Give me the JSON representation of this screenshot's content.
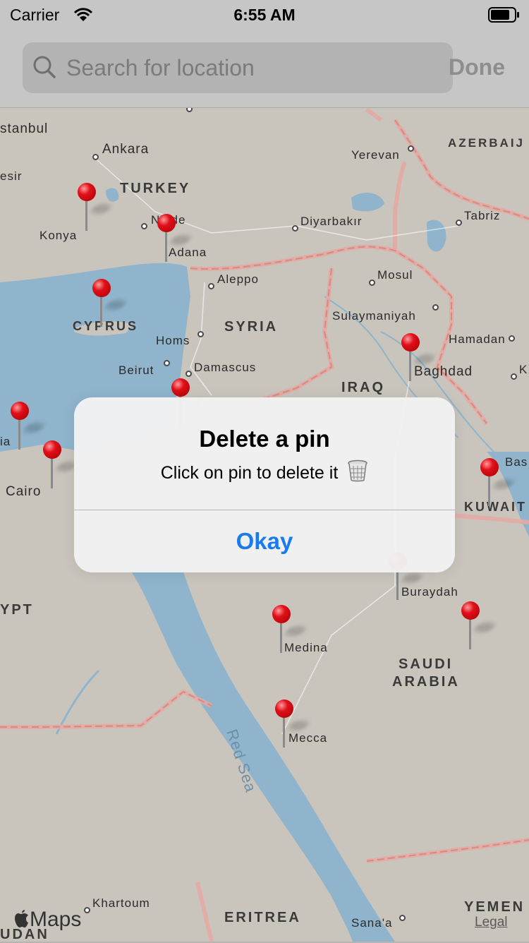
{
  "status_bar": {
    "carrier": "Carrier",
    "time": "6:55 AM"
  },
  "search": {
    "placeholder": "Search for location",
    "done_label": "Done"
  },
  "alert": {
    "title": "Delete a pin",
    "message": "Click on pin to delete it",
    "okay_label": "Okay"
  },
  "map": {
    "countries": [
      "TURKEY",
      "SYRIA",
      "CYPRUS",
      "IRAQ",
      "KUWAIT",
      "SAUDI",
      "ARABIA",
      "AZERBAIJ",
      "YPT",
      "ERITREA",
      "YEMEN",
      "UDAN"
    ],
    "cities": [
      "stanbul",
      "Ankara",
      "esir",
      "Konya",
      "Niğde",
      "Adana",
      "Yerevan",
      "Diyarbakır",
      "Tabriz",
      "Aleppo",
      "Mosul",
      "Sulaymaniyah",
      "Homs",
      "Hamadan",
      "Beirut",
      "Damascus",
      "Baghdad",
      "K",
      "Bas",
      "ia",
      "Cairo",
      "Buraydah",
      "Medina",
      "Mecca",
      "Khartoum",
      "Sana'a"
    ],
    "sea": "Red Sea"
  },
  "footer": {
    "maps_logo": "Maps",
    "legal": "Legal"
  },
  "colors": {
    "land": "#c9c5bd",
    "water": "#8fb4cc",
    "border": "#e4aaa3",
    "pin": "#e0101a",
    "accent": "#1a7bef"
  }
}
